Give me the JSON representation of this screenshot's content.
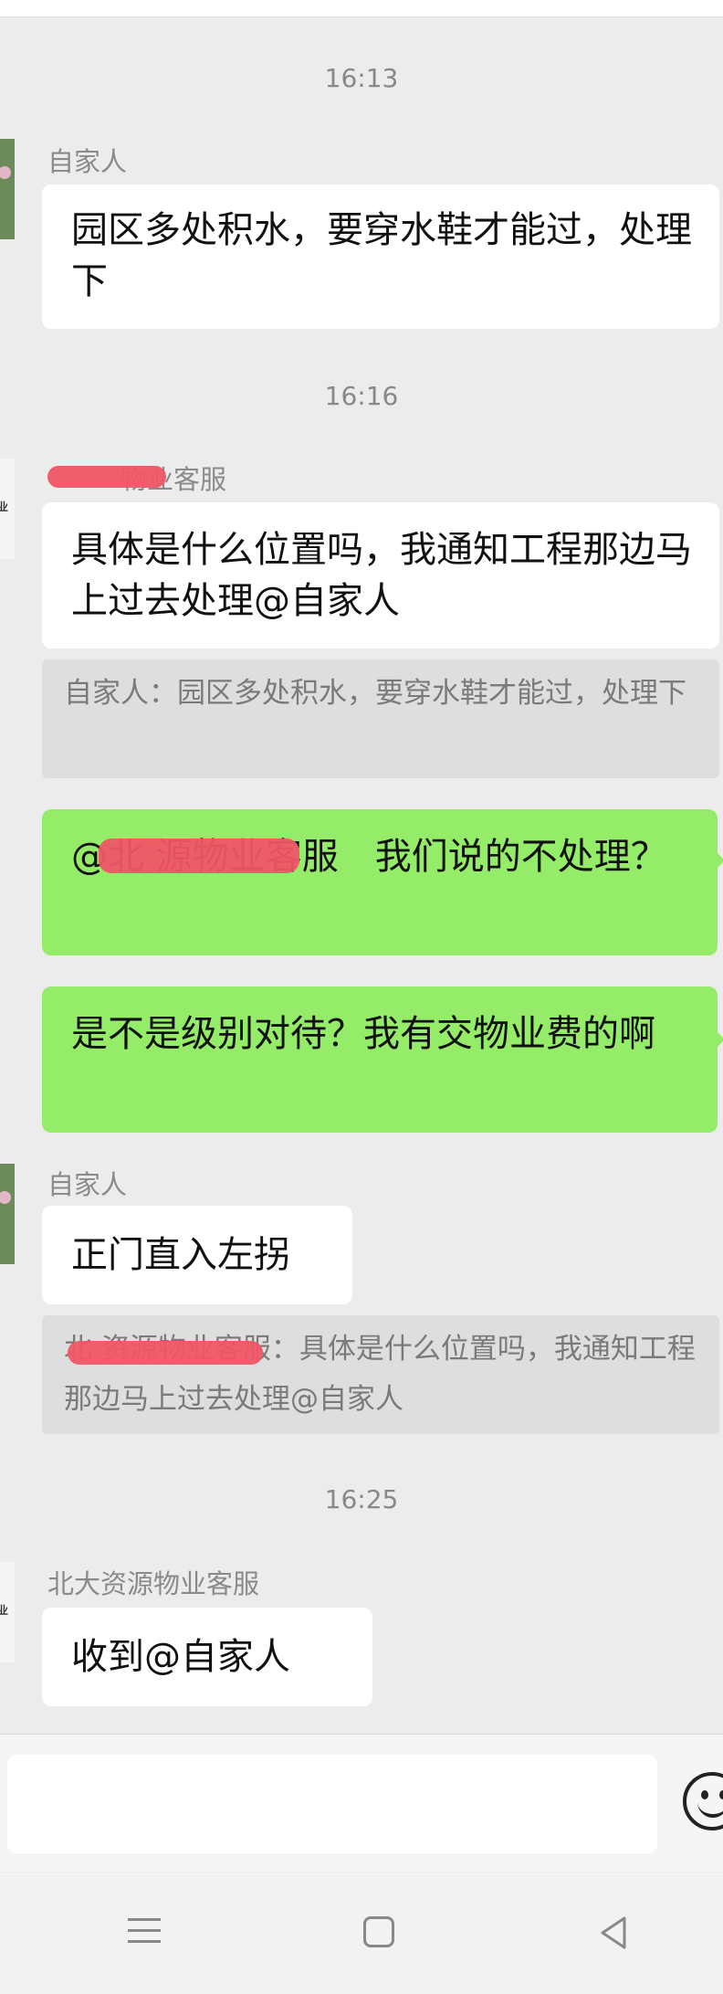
{
  "chat": {
    "time_1": "16:13",
    "sender_1": "自家人",
    "msg_1": "园区多处积水，要穿水鞋才能过，处理下",
    "time_2": "16:16",
    "sender_2": "物业客服",
    "msg_2": "具体是什么位置吗，我通知工程那边马上过去处理@自家人",
    "quote_2": "自家人：园区多处积水，要穿水鞋才能过，处理下",
    "msg_3": "@北 源物业客服　我们说的不处理？",
    "msg_4": "是不是级别对待？我有交物业费的啊",
    "sender_5": "自家人",
    "msg_5": "正门直入左拐",
    "quote_5": "北 资源物业客服：具体是什么位置吗，我通知工程那边马上过去处理@自家人",
    "time_3": "16:25",
    "sender_6": "北大资源物业客服",
    "msg_6": "收到@自家人"
  },
  "avatars": {
    "logo_text": "业"
  },
  "input": {
    "value": ""
  },
  "colors": {
    "background": "#ececec",
    "own_bubble": "#95ec69",
    "other_bubble": "#ffffff",
    "quote": "#dedede",
    "redaction": "#f05667"
  },
  "icons": [
    "emoji-icon",
    "menu-icon",
    "home-icon",
    "back-icon"
  ]
}
